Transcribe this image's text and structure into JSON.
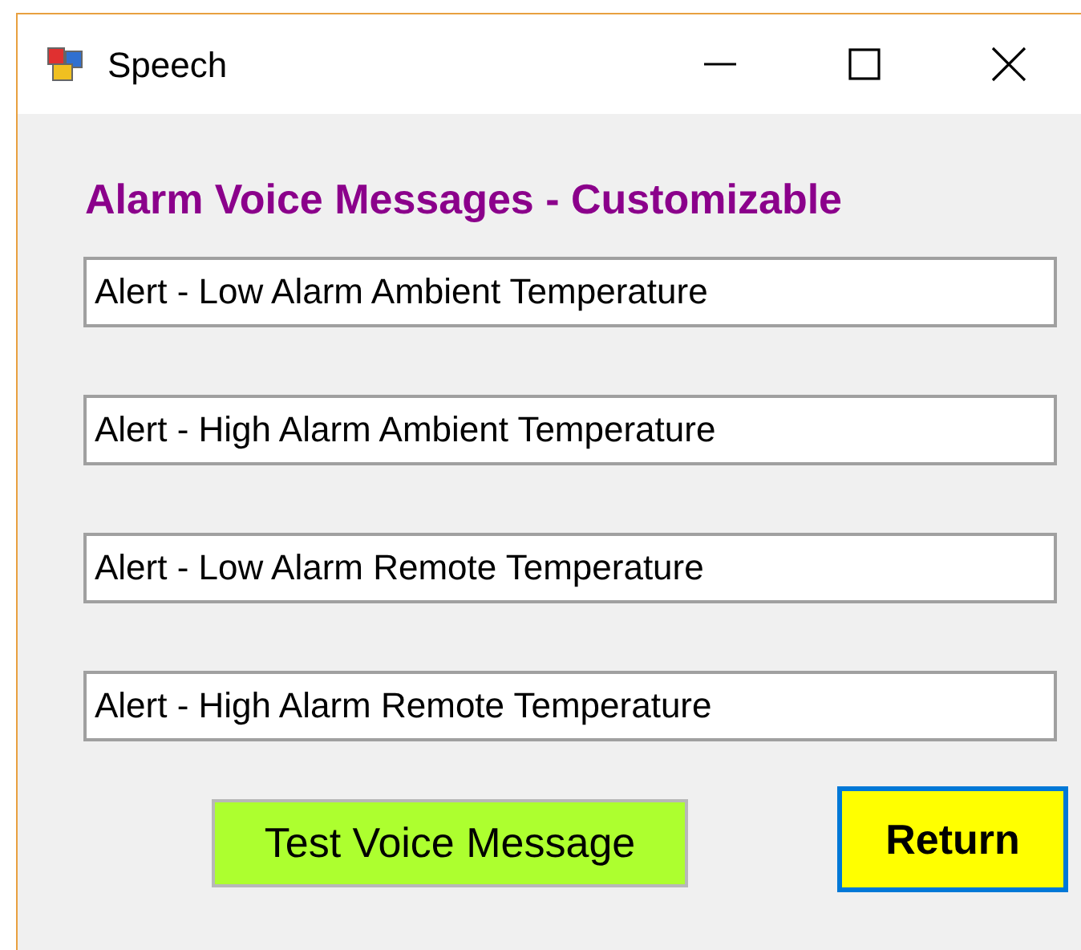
{
  "window": {
    "title": "Speech"
  },
  "heading": "Alarm Voice Messages - Customizable",
  "fields": [
    {
      "value": "Alert - Low Alarm Ambient Temperature"
    },
    {
      "value": "Alert - High Alarm Ambient Temperature"
    },
    {
      "value": "Alert - Low Alarm Remote Temperature"
    },
    {
      "value": "Alert - High Alarm Remote Temperature"
    }
  ],
  "buttons": [
    {
      "label": "Test Voice Message",
      "kind": "test"
    },
    {
      "label": "Return",
      "kind": "default"
    }
  ]
}
